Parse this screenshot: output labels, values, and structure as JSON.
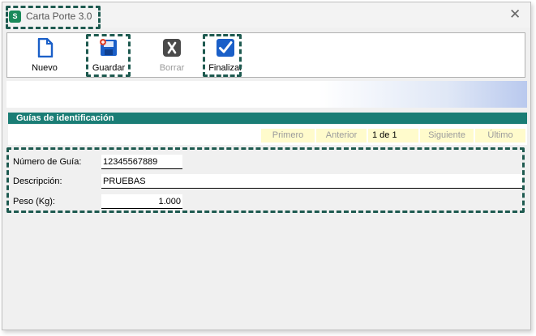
{
  "window": {
    "title": "Carta Porte 3.0",
    "app_icon": "S"
  },
  "toolbar": {
    "nuevo": {
      "label": "Nuevo",
      "icon": "new-document-icon"
    },
    "guardar": {
      "label": "Guardar",
      "icon": "save-icon"
    },
    "borrar": {
      "label": "Borrar",
      "icon": "delete-icon",
      "disabled": true
    },
    "finalizar": {
      "label": "Finalizar",
      "icon": "checkmark-icon"
    }
  },
  "section": {
    "title": "Guías de identificación"
  },
  "navigator": {
    "first": "Primero",
    "previous": "Anterior",
    "counter": "1 de 1",
    "next": "Siguiente",
    "last": "Último"
  },
  "form": {
    "numero_guia": {
      "label": "Número de Guía:",
      "value": "12345567889"
    },
    "descripcion": {
      "label": "Descripción:",
      "value": "PRUEBAS"
    },
    "peso": {
      "label": "Peso (Kg):",
      "value": "1.000"
    }
  },
  "colors": {
    "accent": "#1a7d75",
    "highlight_border": "#1e5a50",
    "nav_background": "#fffbcc",
    "icon_blue": "#1a5fc8",
    "icon_gray": "#4a4a4a"
  }
}
